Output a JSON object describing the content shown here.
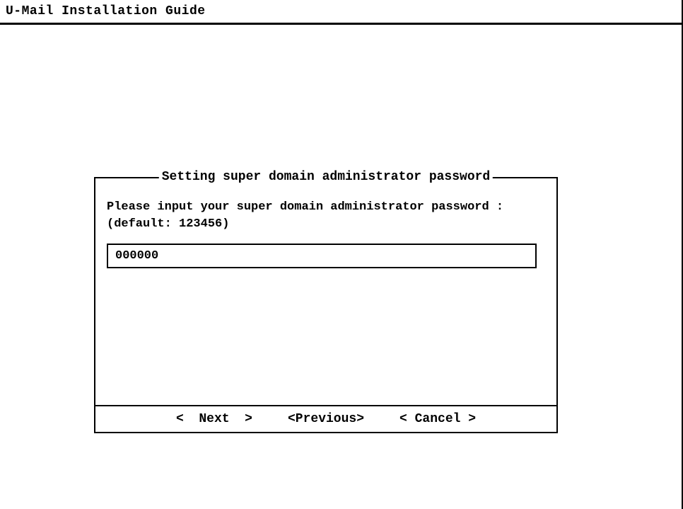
{
  "header": {
    "title": "U-Mail Installation Guide"
  },
  "dialog": {
    "title": "Setting super domain administrator password",
    "prompt_line1": "Please input your super domain administrator password :",
    "prompt_line2": "(default: 123456)",
    "input_value": "000000"
  },
  "buttons": {
    "next": "<  Next  >",
    "previous": "<Previous>",
    "cancel": "< Cancel >"
  }
}
